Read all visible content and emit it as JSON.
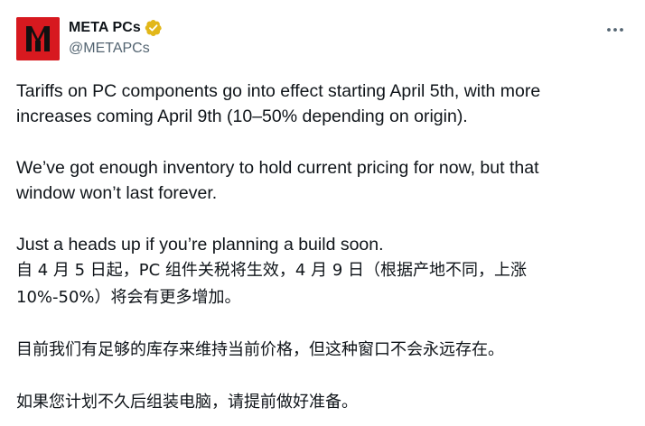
{
  "author": {
    "display_name": "META PCs",
    "handle": "@METAPCs",
    "verified": true,
    "verified_color": "#e2b719",
    "avatar_color": "#d7191f",
    "avatar_icon": "meta-pcs-logo"
  },
  "menu": {
    "icon": "more-horizontal-icon"
  },
  "tweet": {
    "en_paragraphs": [
      "Tariffs on PC components go into effect starting April 5th, with more\nincreases coming April 9th (10–50% depending on origin).",
      "We’ve got enough inventory to hold current pricing for now, but that\nwindow won’t last forever.",
      "Just a heads up if you’re planning a build soon."
    ],
    "cn_paragraphs": [
      "自 4 月 5 日起，PC 组件关税将生效，4 月 9 日（根据产地不同，上涨\n10%-50%）将会有更多增加。",
      "目前我们有足够的库存来维持当前价格，但这种窗口不会永远存在。",
      "如果您计划不久后组装电脑，请提前做好准备。"
    ]
  }
}
